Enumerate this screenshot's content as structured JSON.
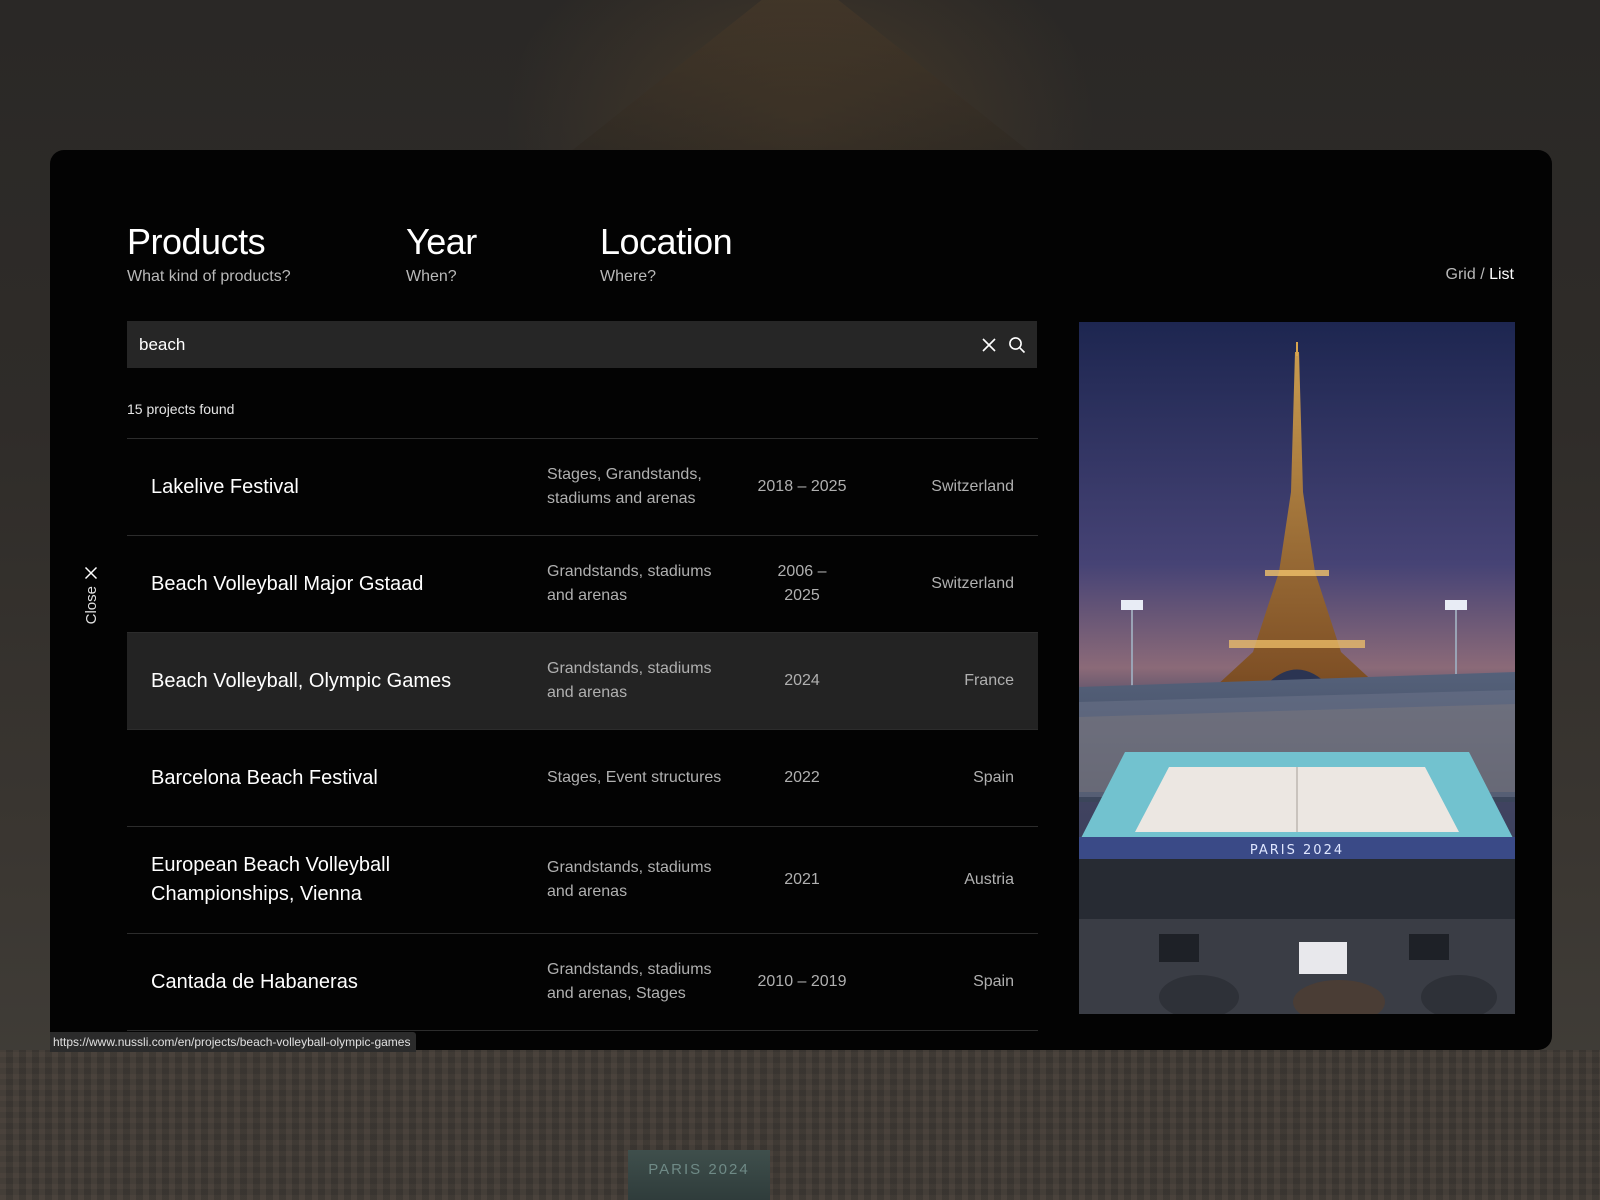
{
  "filters": {
    "products": {
      "title": "Products",
      "subtitle": "What kind of products?"
    },
    "year": {
      "title": "Year",
      "subtitle": "When?"
    },
    "location": {
      "title": "Location",
      "subtitle": "Where?"
    }
  },
  "view_toggle": {
    "grid": "Grid",
    "separator": " / ",
    "list": "List",
    "active": "List"
  },
  "search": {
    "value": "beach"
  },
  "results": {
    "count_label": "15 projects found",
    "rows": [
      {
        "title": "Lakelive Festival",
        "products": "Stages, Grandstands, stadiums and arenas",
        "year": "2018 – 2025",
        "location": "Switzerland"
      },
      {
        "title": "Beach Volleyball Major Gstaad",
        "products": "Grandstands, stadiums and arenas",
        "year": "2006 – 2025",
        "location": "Switzerland"
      },
      {
        "title": "Beach Volleyball, Olympic Games",
        "products": "Grandstands, stadiums and arenas",
        "year": "2024",
        "location": "France"
      },
      {
        "title": "Barcelona Beach Festival",
        "products": "Stages, Event structures",
        "year": "2022",
        "location": "Spain"
      },
      {
        "title": "European Beach Volleyball Championships, Vienna",
        "products": "Grandstands, stadiums and arenas",
        "year": "2021",
        "location": "Austria"
      },
      {
        "title": "Cantada de Habaneras",
        "products": "Grandstands, stadiums and arenas, Stages",
        "year": "2010 – 2019",
        "location": "Spain"
      }
    ]
  },
  "close": {
    "label": "Close"
  },
  "status_bar": {
    "url": "https://www.nussli.com/en/projects/beach-volleyball-olympic-games"
  },
  "background": {
    "banner_text": "PARIS 2024"
  },
  "preview": {
    "banner_text": "PARIS 2024"
  },
  "icons": {
    "clear": "close-x-icon",
    "search": "magnifier-icon",
    "close": "close-x-icon"
  }
}
